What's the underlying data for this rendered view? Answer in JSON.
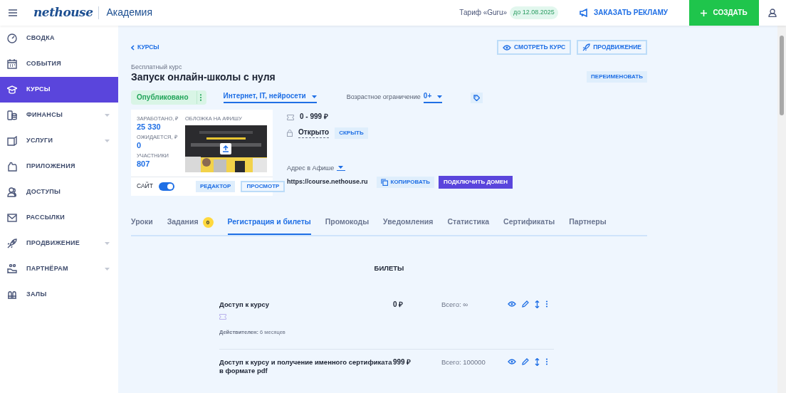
{
  "header": {
    "brand": "nethouse",
    "section": "Академия",
    "tariff": "Тариф «Guru»",
    "tariff_until": "до 12.08.2025",
    "ad_button": "ЗАКАЗАТЬ РЕКЛАМУ",
    "create_button": "СОЗДАТЬ"
  },
  "sidebar": {
    "items": [
      {
        "label": "СВОДКА",
        "selected": false,
        "has_submenu": false
      },
      {
        "label": "СОБЫТИЯ",
        "selected": false,
        "has_submenu": false
      },
      {
        "label": "КУРСЫ",
        "selected": true,
        "has_submenu": false
      },
      {
        "label": "ФИНАНСЫ",
        "selected": false,
        "has_submenu": true
      },
      {
        "label": "УСЛУГИ",
        "selected": false,
        "has_submenu": true
      },
      {
        "label": "ПРИЛОЖЕНИЯ",
        "selected": false,
        "has_submenu": false
      },
      {
        "label": "ДОСТУПЫ",
        "selected": false,
        "has_submenu": false
      },
      {
        "label": "РАССЫЛКИ",
        "selected": false,
        "has_submenu": false
      },
      {
        "label": "ПРОДВИЖЕНИЕ",
        "selected": false,
        "has_submenu": true
      },
      {
        "label": "ПАРТНЁРАМ",
        "selected": false,
        "has_submenu": true
      },
      {
        "label": "ЗАЛЫ",
        "selected": false,
        "has_submenu": false
      }
    ]
  },
  "course": {
    "back_link": "КУРСЫ",
    "view_button": "СМОТРЕТЬ КУРС",
    "promo_button": "ПРОДВИЖЕНИЕ",
    "type": "Бесплатный курс",
    "title": "Запуск онлайн-школы с нуля",
    "rename_button": "ПЕРЕИМЕНОВАТЬ",
    "status": "Опубликовано",
    "category": "Интернет, IT, нейросети",
    "age_label": "Возрастное ограничение",
    "age_value": "0+",
    "stats": [
      {
        "label": "ЗАРАБОТАНО, ₽",
        "value": "25 330"
      },
      {
        "label": "ОЖИДАЕТСЯ, ₽",
        "value": "0"
      },
      {
        "label": "УЧАСТНИКИ",
        "value": "807"
      }
    ],
    "cover_label": "ОБЛОЖКА НА АФИШУ",
    "site_label": "САЙТ",
    "site_on": true,
    "editor_button": "РЕДАКТОР",
    "preview_button": "ПРОСМОТР",
    "price_range": "0 - 999 ₽",
    "access": "Открыто",
    "hide_button": "СКРЫТЬ",
    "address_label": "Адрес в Афише",
    "url": "https://course.nethouse.ru",
    "copy_button": "КОПИРОВАТЬ",
    "domain_button": "ПОДКЛЮЧИТЬ ДОМЕН"
  },
  "tabs": [
    {
      "label": "Уроки",
      "selected": false
    },
    {
      "label": "Задания",
      "selected": false,
      "badge": "0"
    },
    {
      "label": "Регистрация и билеты",
      "selected": true
    },
    {
      "label": "Промокоды",
      "selected": false
    },
    {
      "label": "Уведомления",
      "selected": false
    },
    {
      "label": "Статистика",
      "selected": false
    },
    {
      "label": "Сертификаты",
      "selected": false
    },
    {
      "label": "Партнеры",
      "selected": false
    }
  ],
  "tickets": {
    "title": "БИЛЕТЫ",
    "rows": [
      {
        "name": "Доступ к курсу",
        "price": "0 ₽",
        "total": "Всего: ∞",
        "validity": "**Действителен:** 6 месяцев"
      },
      {
        "name": "Доступ к курсу и получение именного сертификата в формате pdf",
        "price": "999 ₽",
        "total": "Всего: 100000"
      }
    ]
  }
}
